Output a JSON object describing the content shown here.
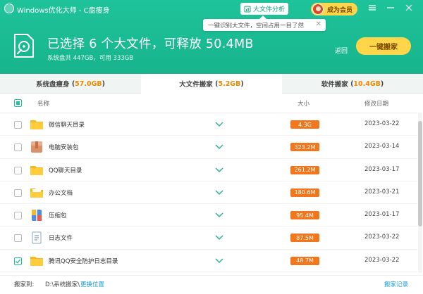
{
  "window": {
    "title": "Windows优化大师 - C盘瘦身",
    "analysis_button": "大文件分析",
    "vip_button": "成为会员"
  },
  "tooltip": {
    "text": "一键识别大文件，空间占用一目了然"
  },
  "summary": {
    "headline": "已选择 6 个大文件，可释放 50.4MB",
    "disk_info": "系统盘共 447GB，可用 333GB",
    "back_label": "返回",
    "move_button": "一键搬家"
  },
  "tabs": [
    {
      "label": "系统盘瘦身",
      "size": "57.0GB",
      "active": false
    },
    {
      "label": "大文件搬家",
      "size": "5.2GB",
      "active": true
    },
    {
      "label": "软件搬家",
      "size": "10.4GB",
      "active": false
    }
  ],
  "table": {
    "headers": {
      "name": "名称",
      "size": "大小",
      "date": "修改日期"
    },
    "rows": [
      {
        "name": "微信聊天目录",
        "size": "4.3G",
        "date": "2023-03-22",
        "icon": "folder-icon",
        "checked": false
      },
      {
        "name": "电脑安装包",
        "size": "323.2M",
        "date": "2023-03-14",
        "icon": "package-icon",
        "checked": false
      },
      {
        "name": "QQ聊天目录",
        "size": "261.2M",
        "date": "2023-03-17",
        "icon": "folder-icon",
        "checked": false
      },
      {
        "name": "办公文档",
        "size": "180.6M",
        "date": "2023-03-21",
        "icon": "document-folder-icon",
        "checked": false
      },
      {
        "name": "压缩包",
        "size": "95.4M",
        "date": "2023-01-17",
        "icon": "archive-icon",
        "checked": false
      },
      {
        "name": "日志文件",
        "size": "87.5M",
        "date": "2023-03-22",
        "icon": "log-file-icon",
        "checked": false
      },
      {
        "name": "腾讯QQ安全防护日志目录",
        "size": "48.7M",
        "date": "2023-03-22",
        "icon": "folder-icon",
        "checked": true
      }
    ]
  },
  "footer": {
    "label": "搬家到:",
    "path": "D:\\系统搬家\\",
    "change_location": "更换位置",
    "record": "搬家记录"
  },
  "colors": {
    "header_green": "#1fc39a",
    "accent_yellow": "#ffd64a",
    "size_badge": "#f2761c",
    "tab_size_orange": "#ee8a00",
    "link_blue": "#1a9fd8"
  }
}
